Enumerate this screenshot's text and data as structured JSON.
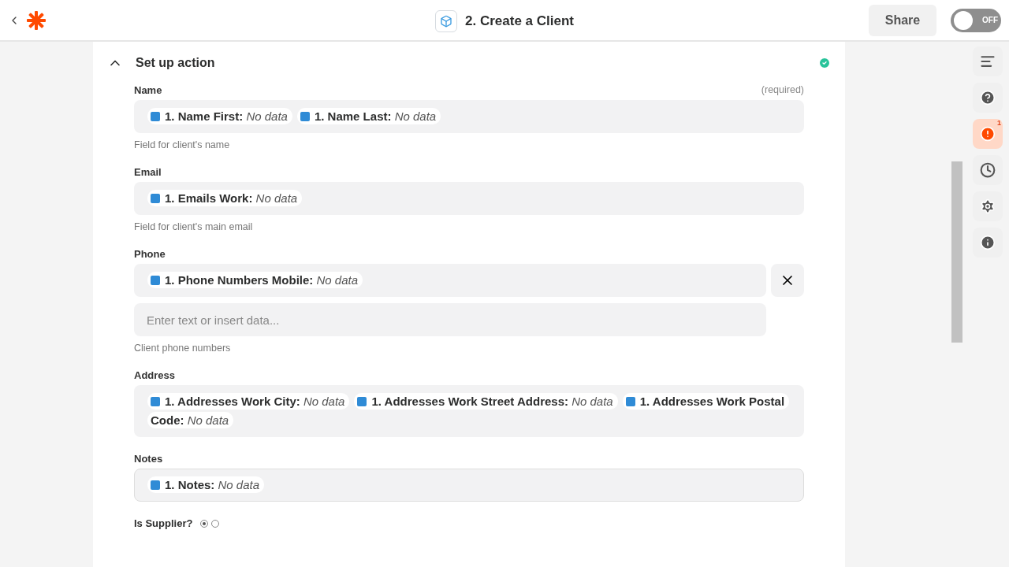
{
  "header": {
    "title": "2. Create a Client",
    "share": "Share",
    "toggle": {
      "label": "OFF",
      "on": false
    }
  },
  "section": {
    "title": "Set up action",
    "expanded": true,
    "complete": true,
    "fields": [
      {
        "label": "Name",
        "required": "(required)",
        "rows": [
          {
            "tokens": [
              {
                "label": "1. Name First:",
                "value": "No data"
              },
              {
                "label": "1. Name Last:",
                "value": "No data"
              }
            ]
          }
        ],
        "help": "Field for client's name"
      },
      {
        "label": "Email",
        "rows": [
          {
            "tokens": [
              {
                "label": "1. Emails Work:",
                "value": "No data"
              }
            ]
          }
        ],
        "help": "Field for client's main email"
      },
      {
        "label": "Phone",
        "rows": [
          {
            "tokens": [
              {
                "label": "1. Phone Numbers Mobile:",
                "value": "No data"
              }
            ],
            "removable": true
          },
          {
            "placeholder": "Enter text or insert data..."
          }
        ],
        "help": "Client phone numbers"
      },
      {
        "label": "Address",
        "rows": [
          {
            "tokens": [
              {
                "label": "1. Addresses Work City:",
                "value": "No data"
              },
              {
                "label": "1. Addresses Work Street Address:",
                "value": "No data"
              },
              {
                "label": "1. Addresses Work Postal Code:",
                "value": "No data"
              }
            ]
          }
        ]
      },
      {
        "label": "Notes",
        "focused": true,
        "rows": [
          {
            "tokens": [
              {
                "label": "1. Notes:",
                "value": "No data"
              }
            ]
          }
        ]
      }
    ],
    "radio": {
      "label": "Is Supplier?",
      "options": [
        {
          "selected": true
        },
        {
          "selected": false
        }
      ]
    }
  },
  "rail": [
    {
      "kind": "outline",
      "selected": false
    },
    {
      "kind": "help",
      "selected": false
    },
    {
      "kind": "alert",
      "selected": true,
      "badge": "1"
    },
    {
      "kind": "history",
      "selected": false
    },
    {
      "kind": "settings",
      "selected": false
    },
    {
      "kind": "info",
      "selected": false
    }
  ]
}
